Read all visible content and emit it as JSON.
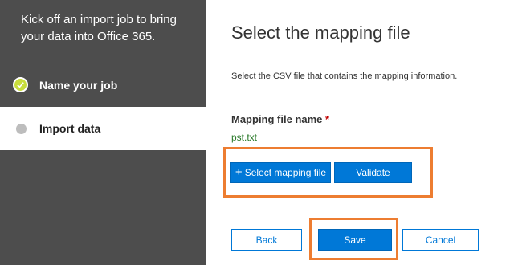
{
  "sidebar": {
    "intro": "Kick off an import job to bring your data into Office 365.",
    "steps": [
      {
        "label": "Name your job",
        "state": "completed"
      },
      {
        "label": "Import data",
        "state": "current"
      }
    ]
  },
  "main": {
    "title": "Select the mapping file",
    "description": "Select the CSV file that contains the mapping information.",
    "field_label": "Mapping file name",
    "required_marker": "*",
    "file_name": "pst.txt",
    "select_button": "Select mapping file",
    "validate_button": "Validate"
  },
  "footer": {
    "back": "Back",
    "save": "Save",
    "cancel": "Cancel"
  },
  "colors": {
    "sidebar_bg": "#4d4d4d",
    "accent": "#0078d7",
    "highlight": "#ed7d31",
    "completed_dot": "#c8dd3c"
  }
}
